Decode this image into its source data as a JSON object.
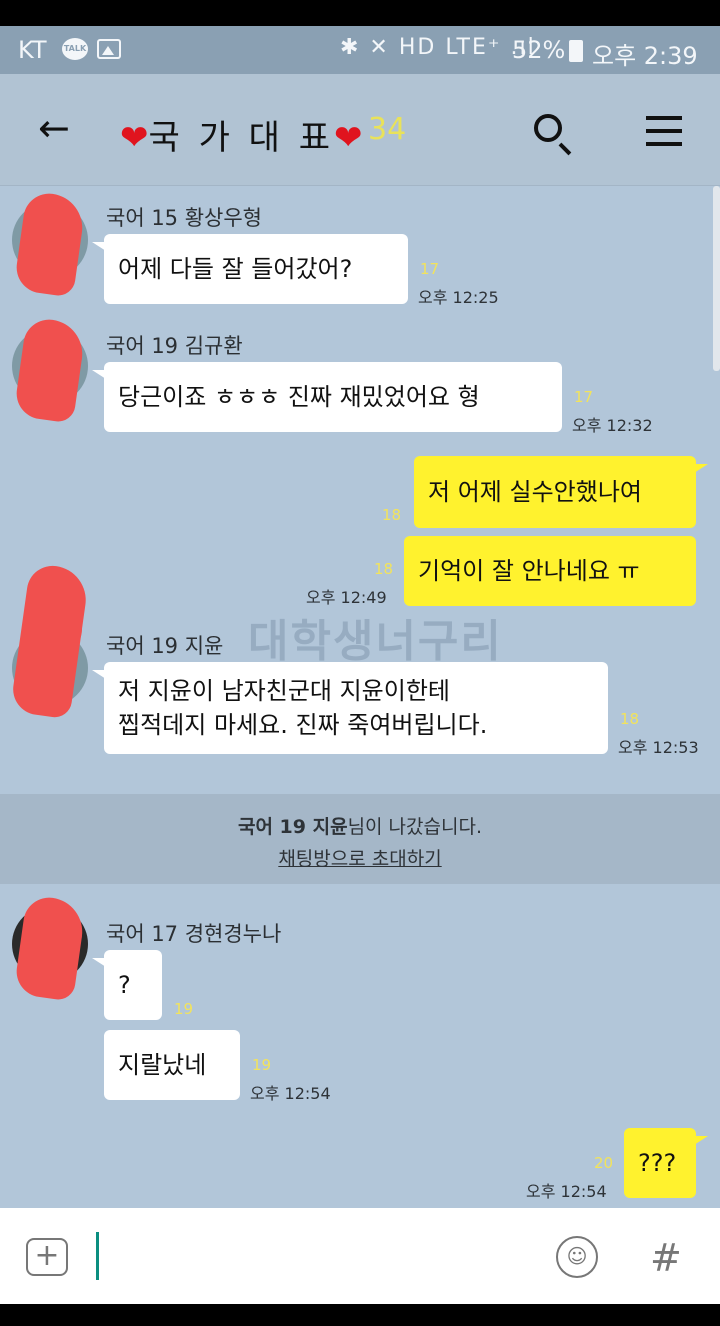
{
  "status_bar": {
    "carrier": "KT",
    "talk_badge": "TALK",
    "icons": "✱ ✕ HD LTE⁺ .ıl",
    "battery": "52%",
    "time": "오후 2:39"
  },
  "header": {
    "title": "국 가 대 표",
    "member_count": "34",
    "heart": "❤",
    "back_icon": "←",
    "search_icon": "search-icon",
    "menu_icon": "menu-icon"
  },
  "watermark": "대학생너구리",
  "messages": [
    {
      "sender": "국어 15 황상우형",
      "text": "어제 다들 잘 들어갔어?",
      "read": "17",
      "time": "오후 12:25"
    },
    {
      "sender": "국어 19 김규환",
      "text": "당근이죠 ㅎㅎㅎ 진짜 재밌었어요 형",
      "read": "17",
      "time": "오후 12:32"
    },
    {
      "sender": "me",
      "text": "저 어제 실수안했나여",
      "read": "18"
    },
    {
      "sender": "me",
      "text": "기억이 잘 안나네요 ㅠ",
      "read": "18",
      "time": "오후 12:49"
    },
    {
      "sender": "국어 19 지윤",
      "line1": "저 지윤이 남자친군대 지윤이한테",
      "line2": "찝적데지 마세요. 진짜 죽여버립니다.",
      "read": "18",
      "time": "오후 12:53"
    },
    {
      "sender": "국어 17 경현경누나",
      "text": "?",
      "read": "19"
    },
    {
      "sender": "국어 17 경현경누나",
      "text": "지랄났네",
      "read": "19",
      "time": "오후 12:54"
    },
    {
      "sender": "me",
      "text": "???",
      "read": "20",
      "time": "오후 12:54"
    }
  ],
  "notice": {
    "name": "국어 19 지윤",
    "suffix": "님이 나갔습니다.",
    "invite": "채팅방으로 초대하기"
  },
  "input_bar": {
    "plus": "+",
    "emoji": "☺",
    "hash": "#"
  }
}
